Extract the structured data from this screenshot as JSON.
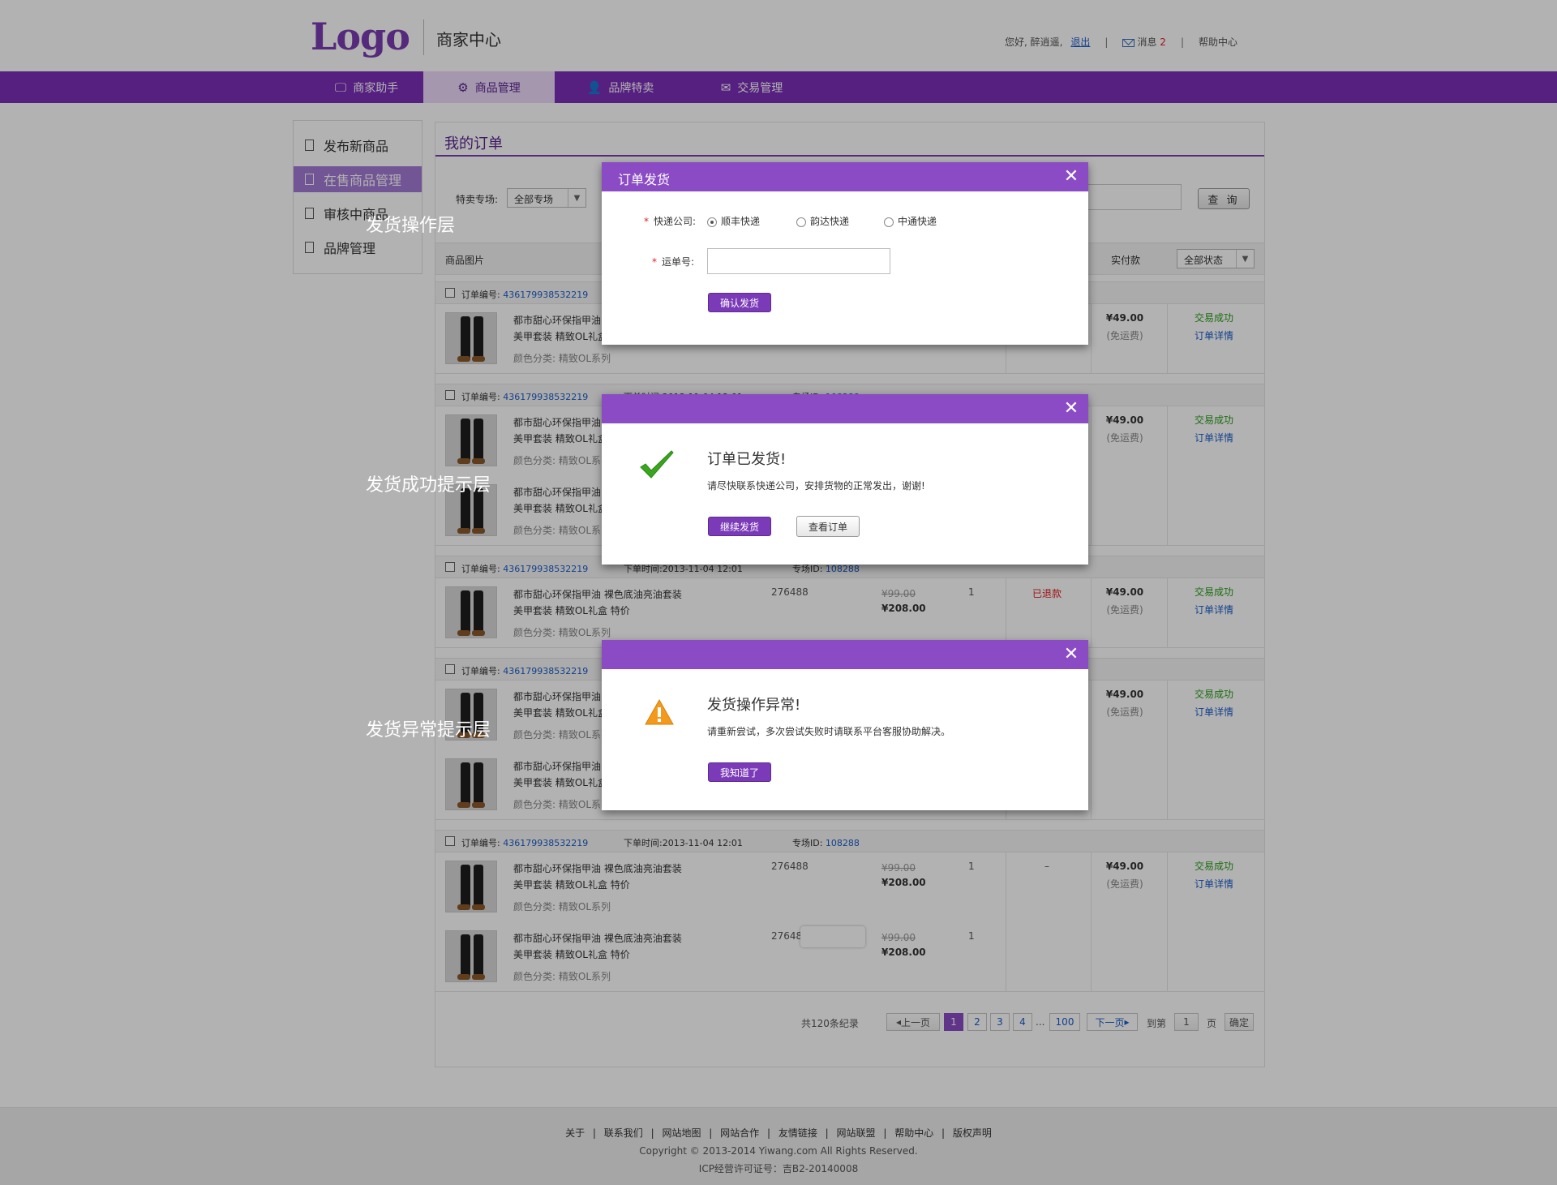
{
  "header": {
    "logo": "Logo",
    "center_title": "商家中心",
    "greeting": "您好, 醉逍遥,",
    "logout": "退出",
    "messages_label": "消息",
    "messages_count": "2",
    "help": "帮助中心"
  },
  "nav": [
    {
      "label": "商家助手",
      "icon": "monitor-icon"
    },
    {
      "label": "商品管理",
      "icon": "gear-icon"
    },
    {
      "label": "品牌特卖",
      "icon": "user-icon"
    },
    {
      "label": "交易管理",
      "icon": "mail-icon"
    }
  ],
  "sidebar": {
    "items": [
      {
        "label": "发布新商品"
      },
      {
        "label": "在售商品管理"
      },
      {
        "label": "审核中商品"
      },
      {
        "label": "品牌管理"
      }
    ]
  },
  "main": {
    "title": "我的订单",
    "filter_label": "特卖专场:",
    "filter_value": "全部专场",
    "query_button": "查 询",
    "col_image": "商品图片",
    "col_paid": "实付款",
    "status_filter": "全部状态"
  },
  "orders": {
    "no_label": "订单编号:",
    "order_no": "436179938532219",
    "time_label": "下单时间:",
    "time": "2013-11-04 12:01",
    "venue_label": "专场ID:",
    "venue_id": "108288",
    "product_line1": "都市甜心环保指甲油 裸色底油亮油套装",
    "product_line2": "美甲套装 精致OL礼盒 特价",
    "color_label": "颜色分类:",
    "color_value": "精致OL系列",
    "code": "276488",
    "old_price": "¥99.00",
    "new_price": "¥208.00",
    "qty": "1",
    "refunded": "已退款",
    "dash": "–",
    "paid": "¥49.00",
    "free_ship": "(免运费)",
    "status_ok": "交易成功",
    "detail_link": "订单详情"
  },
  "pager": {
    "total": "共120条纪录",
    "prev": "上一页",
    "pages": [
      "1",
      "2",
      "3",
      "4"
    ],
    "ellipsis": "...",
    "last": "100",
    "next": "下一页",
    "goto_label": "到第",
    "goto_value": "1",
    "page_label": "页",
    "confirm": "确定"
  },
  "annotations": {
    "a1": "发货操作层",
    "a2": "发货成功提示层",
    "a3": "发货异常提示层"
  },
  "modal_ship": {
    "title": "订单发货",
    "courier_label": "快递公司:",
    "options": [
      "顺丰快递",
      "韵达快递",
      "中通快递"
    ],
    "tracking_label": "运单号:",
    "confirm": "确认发货"
  },
  "modal_success": {
    "title": "订单已发货!",
    "desc": "请尽快联系快递公司，安排货物的正常发出，谢谢!",
    "continue": "继续发货",
    "view": "查看订单"
  },
  "modal_error": {
    "title": "发货操作异常!",
    "desc": "请重新尝试，多次尝试失败时请联系平台客服协助解决。",
    "ok": "我知道了"
  },
  "footer": {
    "links": [
      "关于",
      "联系我们",
      "网站地图",
      "网站合作",
      "友情链接",
      "网站联盟",
      "帮助中心",
      "版权声明"
    ],
    "copyright": "Copyright © 2013-2014 Yiwang.com All Rights Reserved.",
    "icp": "ICP经营许可证号：吉B2-20140008"
  },
  "colors": {
    "brand": "#7a2fb8",
    "modal_header": "#8a4bc4",
    "success": "#2a9d1a",
    "link": "#1a5cc8",
    "danger": "#e02020"
  }
}
